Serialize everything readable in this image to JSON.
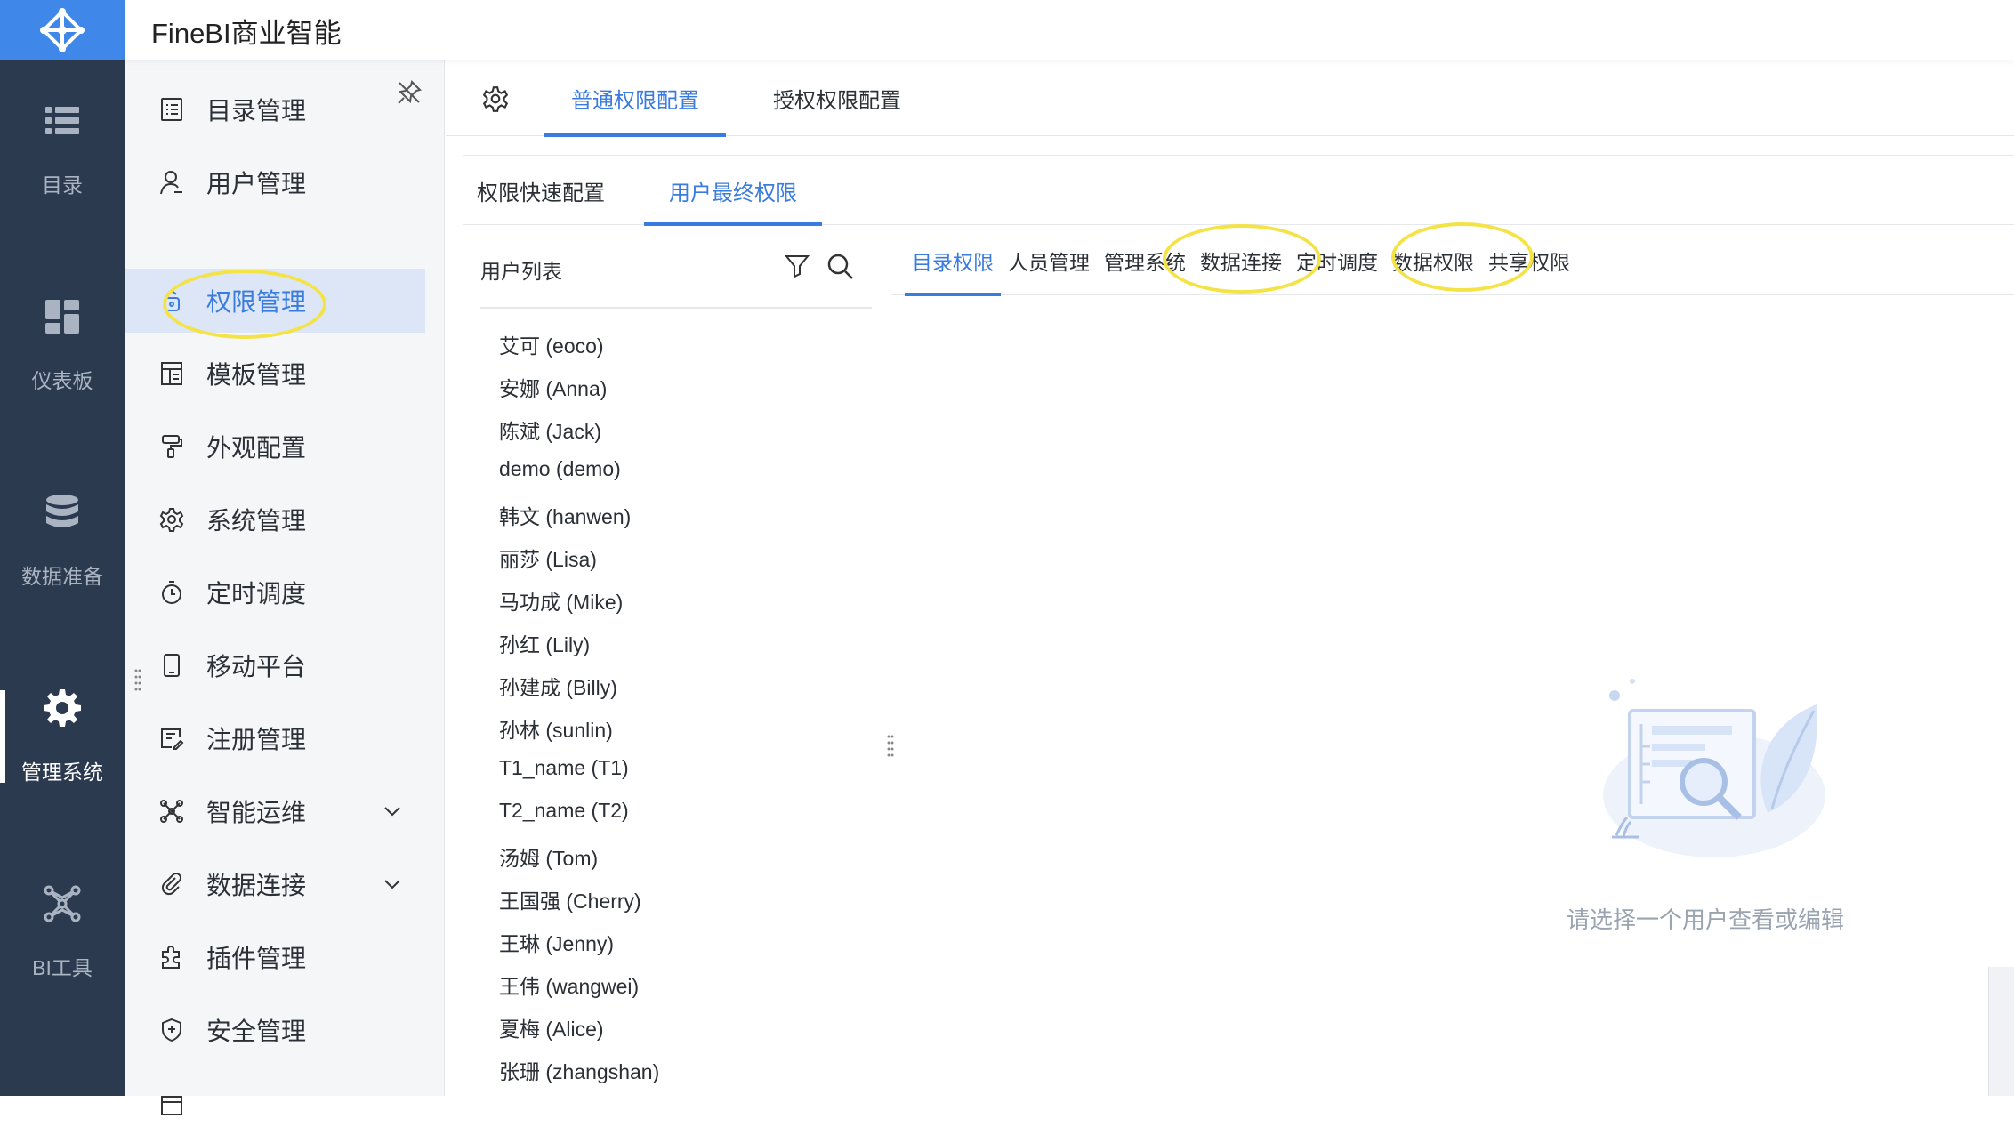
{
  "app": {
    "title": "FineBI商业智能"
  },
  "rail": [
    {
      "label": "目录",
      "icon": "list-icon",
      "active": false
    },
    {
      "label": "仪表板",
      "icon": "dashboard-icon",
      "active": false
    },
    {
      "label": "数据准备",
      "icon": "database-icon",
      "active": false
    },
    {
      "label": "管理系统",
      "icon": "gear-icon",
      "active": true
    },
    {
      "label": "BI工具",
      "icon": "network-icon",
      "active": false
    }
  ],
  "sidebar": {
    "items": [
      {
        "label": "目录管理",
        "icon": "catalog-icon"
      },
      {
        "label": "用户管理",
        "icon": "user-icon"
      },
      {
        "label": "权限管理",
        "icon": "permission-icon",
        "active": true
      },
      {
        "label": "模板管理",
        "icon": "template-icon"
      },
      {
        "label": "外观配置",
        "icon": "paint-roller-icon"
      },
      {
        "label": "系统管理",
        "icon": "settings-icon"
      },
      {
        "label": "定时调度",
        "icon": "timer-icon"
      },
      {
        "label": "移动平台",
        "icon": "mobile-icon"
      },
      {
        "label": "注册管理",
        "icon": "register-icon"
      },
      {
        "label": "智能运维",
        "icon": "ops-icon",
        "expandable": true
      },
      {
        "label": "数据连接",
        "icon": "link-icon",
        "expandable": true
      },
      {
        "label": "插件管理",
        "icon": "plugin-icon"
      },
      {
        "label": "安全管理",
        "icon": "shield-icon"
      }
    ]
  },
  "main": {
    "top_tabs": [
      {
        "label": "普通权限配置",
        "active": true
      },
      {
        "label": "授权权限配置",
        "active": false
      }
    ],
    "sub_tabs": [
      {
        "label": "权限快速配置",
        "active": false
      },
      {
        "label": "用户最终权限",
        "active": true
      }
    ],
    "user_list": {
      "title": "用户列表",
      "users": [
        "艾可 (eoco)",
        "安娜 (Anna)",
        "陈斌 (Jack)",
        "demo (demo)",
        "韩文 (hanwen)",
        "丽莎 (Lisa)",
        "马功成 (Mike)",
        "孙红 (Lily)",
        "孙建成 (Billy)",
        "孙林 (sunlin)",
        "T1_name (T1)",
        "T2_name (T2)",
        "汤姆 (Tom)",
        "王国强 (Cherry)",
        "王琳 (Jenny)",
        "王伟 (wangwei)",
        "夏梅 (Alice)",
        "张珊 (zhangshan)"
      ]
    },
    "perm_tabs": [
      {
        "label": "目录权限",
        "active": true
      },
      {
        "label": "人员管理",
        "active": false
      },
      {
        "label": "管理系统",
        "active": false
      },
      {
        "label": "数据连接",
        "active": false,
        "highlighted": true
      },
      {
        "label": "定时调度",
        "active": false
      },
      {
        "label": "数据权限",
        "active": false,
        "highlighted": true
      },
      {
        "label": "共享权限",
        "active": false
      }
    ],
    "empty_state": {
      "text": "请选择一个用户查看或编辑"
    }
  },
  "colors": {
    "rail_bg": "#2c3a50",
    "brand": "#3f88ea",
    "accent": "#3a7be0",
    "highlight": "#f4e347"
  }
}
